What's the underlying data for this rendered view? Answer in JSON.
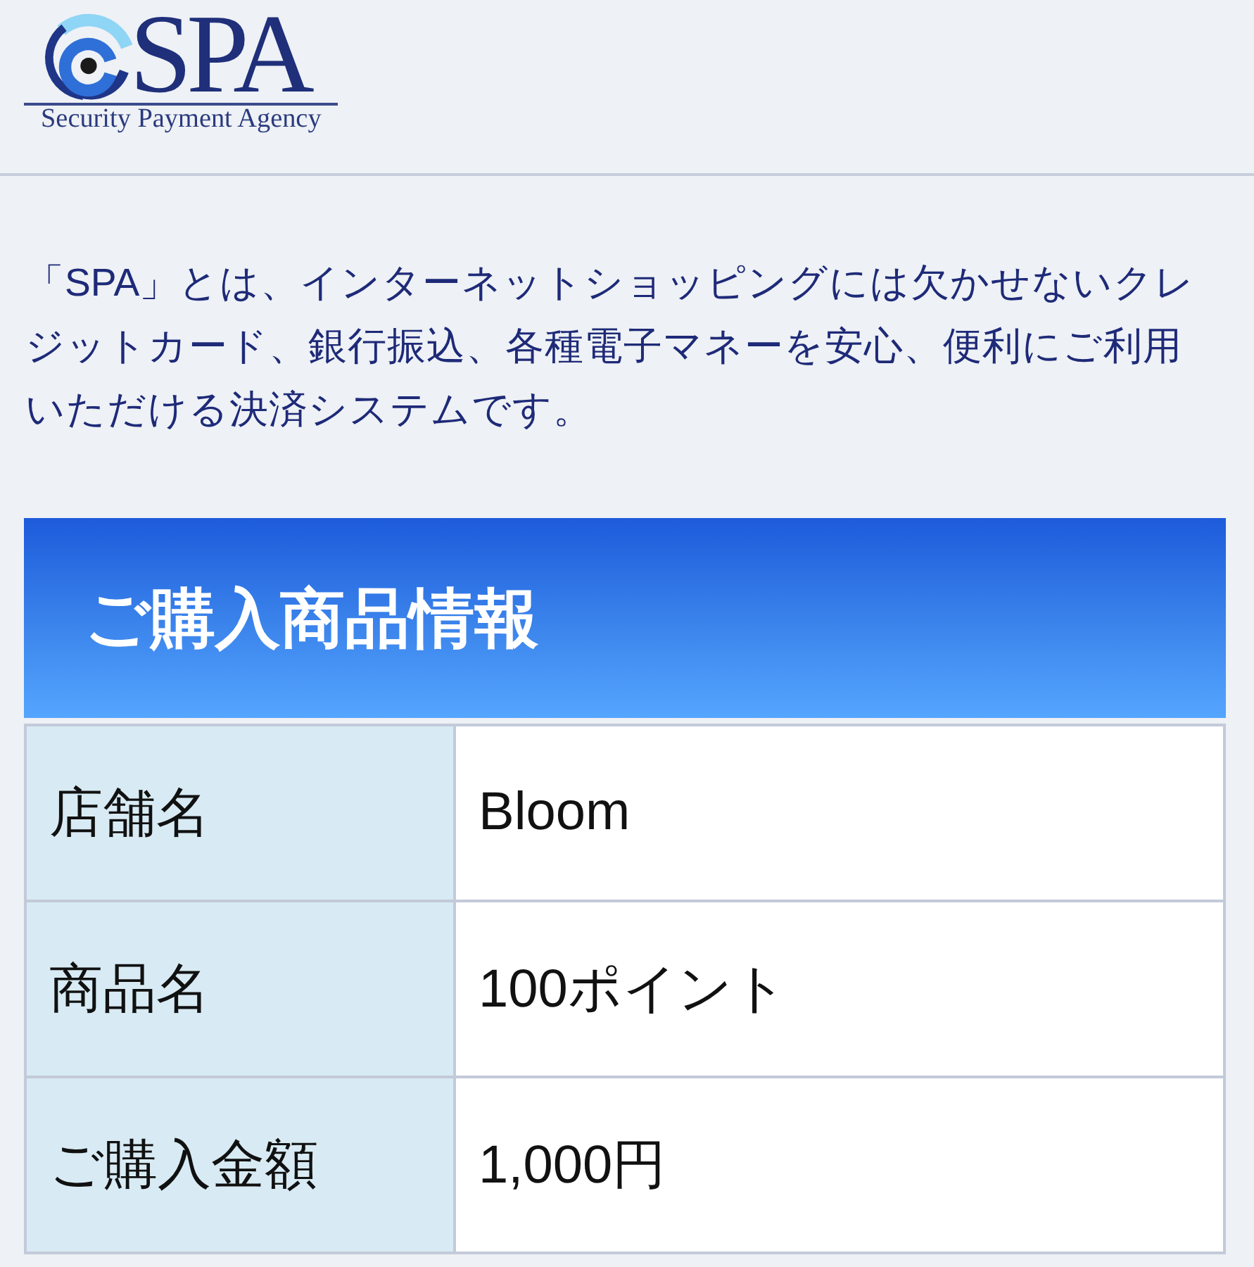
{
  "header": {
    "logo": {
      "name": "SPA",
      "tagline": "Security Payment Agency"
    }
  },
  "intro": "「SPA」とは、インターネットショッピングには欠かせないクレジットカード、銀行振込、各種電子マネーを安心、便利にご利用いただける決済システムです。",
  "purchase_info": {
    "title": "ご購入商品情報",
    "rows": [
      {
        "label": "店舗名",
        "value": "Bloom"
      },
      {
        "label": "商品名",
        "value": "100ポイント"
      },
      {
        "label": "ご購入金額",
        "value": "1,000円"
      }
    ]
  }
}
